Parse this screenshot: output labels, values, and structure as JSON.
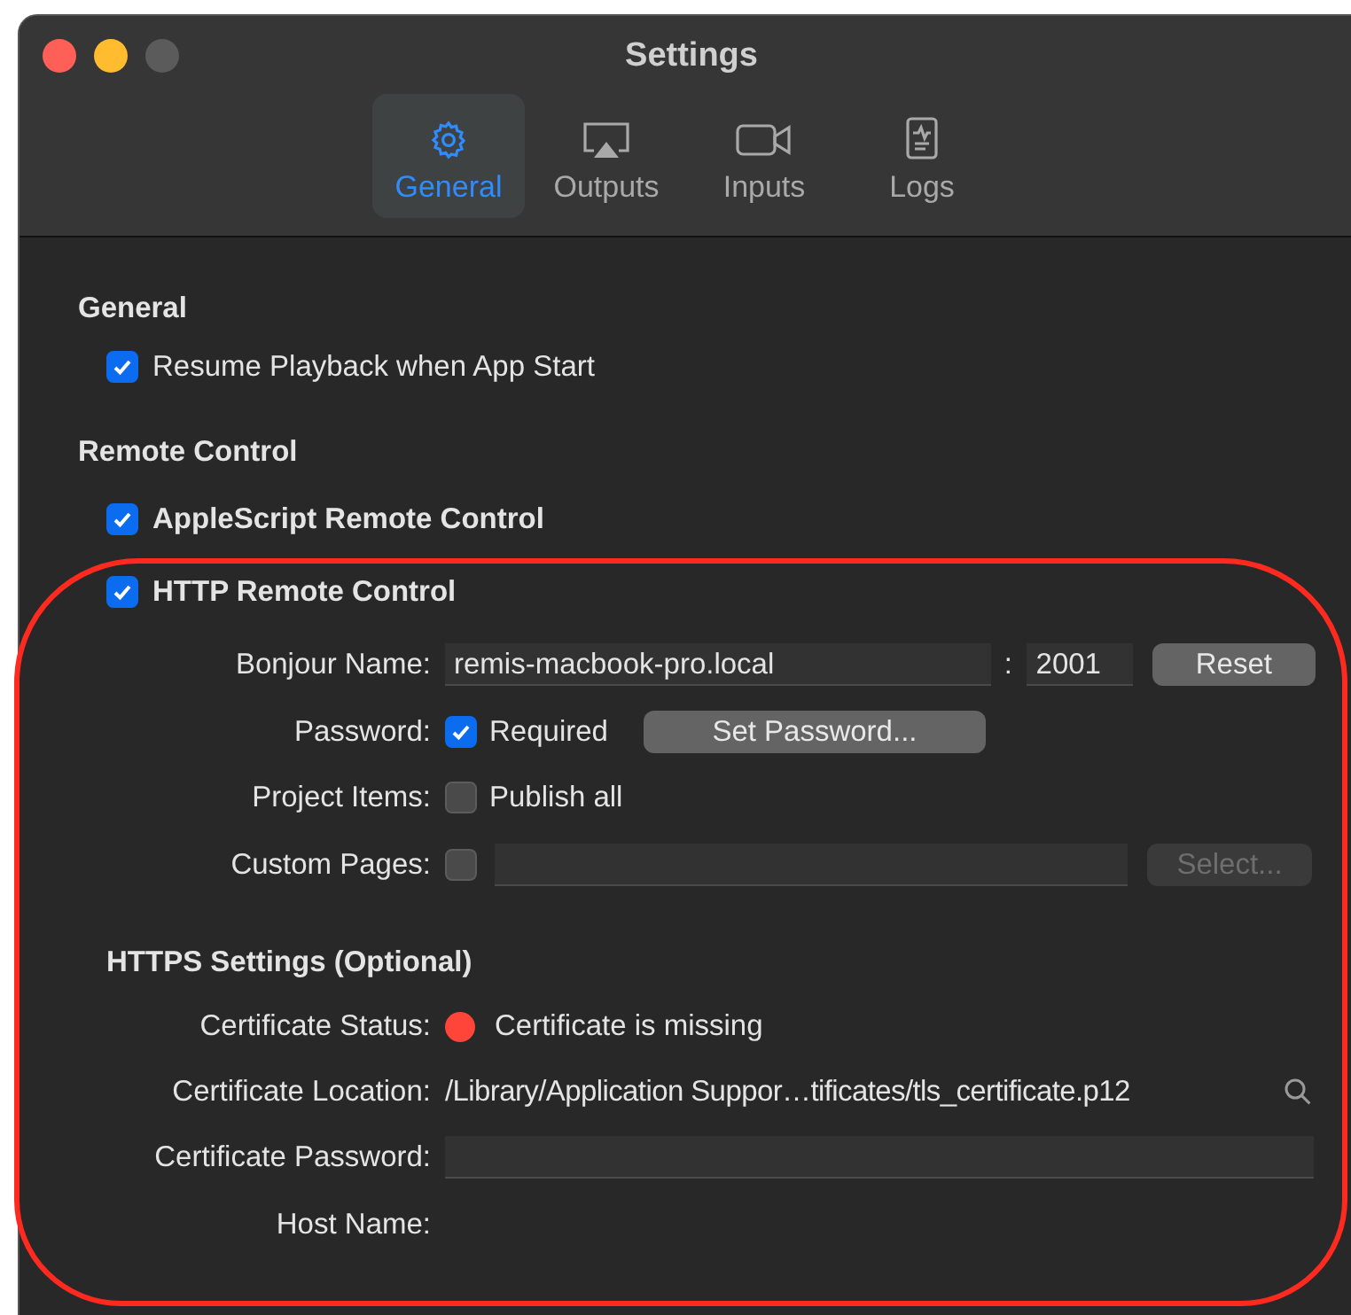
{
  "window": {
    "title": "Settings"
  },
  "tabs": [
    {
      "label": "General",
      "selected": true
    },
    {
      "label": "Outputs",
      "selected": false
    },
    {
      "label": "Inputs",
      "selected": false
    },
    {
      "label": "Logs",
      "selected": false
    }
  ],
  "general": {
    "heading": "General",
    "options": [
      {
        "label": "Resume Playback when App Start",
        "checked": true,
        "bold": false
      }
    ]
  },
  "remote_control": {
    "heading": "Remote Control",
    "options": [
      {
        "label": "AppleScript Remote Control",
        "checked": true,
        "bold": true
      },
      {
        "label": "HTTP Remote Control",
        "checked": true,
        "bold": true
      }
    ],
    "http_settings": [
      {
        "kind": "name_port",
        "label": "Bonjour Name:",
        "value": "remis-macbook-pro.local",
        "separator": ":",
        "port": "2001",
        "button": "Reset"
      },
      {
        "kind": "checkbox_button",
        "label": "Password:",
        "checked": true,
        "option": "Required",
        "button": "Set Password..."
      },
      {
        "kind": "checkbox",
        "label": "Project Items:",
        "checked": false,
        "option": "Publish all"
      },
      {
        "kind": "checkbox_field_button",
        "label": "Custom Pages:",
        "checked": false,
        "button": "Select...",
        "disabled": true
      }
    ]
  },
  "https_settings": {
    "heading": "HTTPS Settings (Optional)",
    "rows": [
      {
        "kind": "status",
        "label": "Certificate Status:",
        "color": "#ff453a",
        "text": "Certificate is missing"
      },
      {
        "kind": "path",
        "label": "Certificate Location:",
        "value": "/Library/Application Suppor…tificates/tls_certificate.p12"
      },
      {
        "kind": "field",
        "label": "Certificate Password:"
      },
      {
        "kind": "empty",
        "label": "Host Name:"
      }
    ]
  }
}
